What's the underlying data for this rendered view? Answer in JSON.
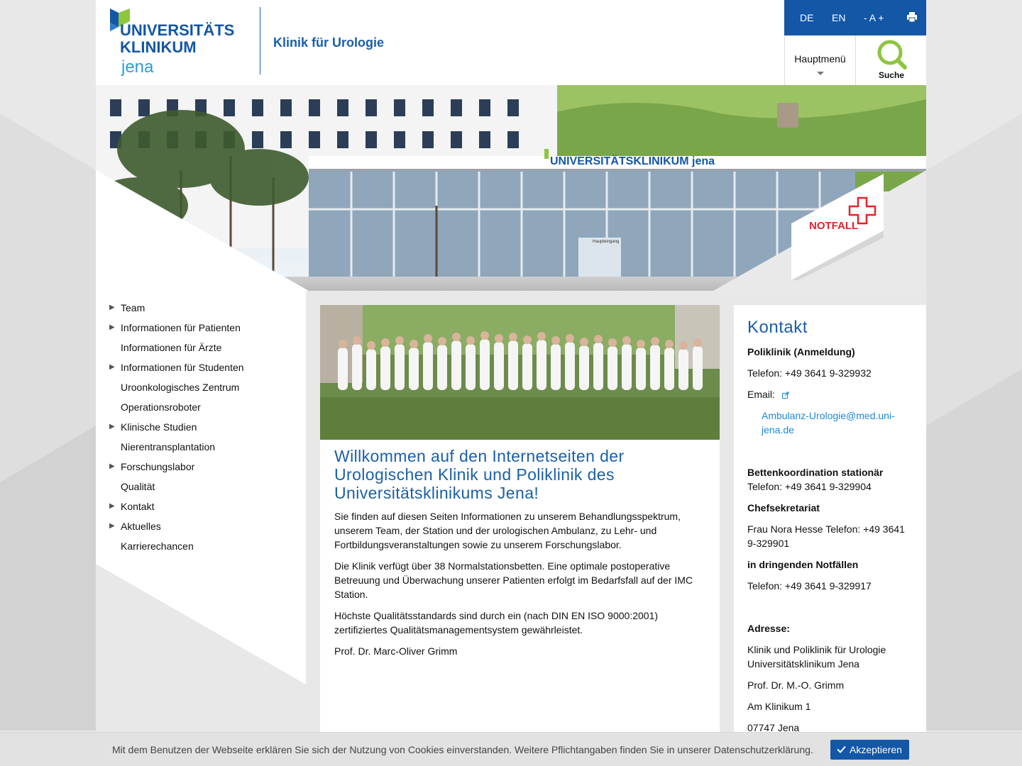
{
  "header": {
    "logo_line1": "UNIVERSITÄTS",
    "logo_line2": "KLINIKUM",
    "logo_line3": "jena",
    "clinic_title": "Klinik für Urologie",
    "lang_de": "DE",
    "lang_en": "EN",
    "font_size": "- A +",
    "menu_label": "Hauptmenü",
    "search_label": "Suche",
    "brand_color": "#1357a6",
    "logo_green": "#8dc63f"
  },
  "hero": {
    "building_sign": "UNIVERSITÄTSKLINIKUM jena",
    "entrance_sign": "Haupteingang",
    "emergency_label": "NOTFALL"
  },
  "sidebar": {
    "items": [
      {
        "label": "Team",
        "has_children": true
      },
      {
        "label": "Informationen für Patienten",
        "has_children": true
      },
      {
        "label": "Informationen für Ärzte",
        "has_children": false
      },
      {
        "label": "Informationen für Studenten",
        "has_children": true
      },
      {
        "label": "Uroonkologisches Zentrum",
        "has_children": false
      },
      {
        "label": "Operationsroboter",
        "has_children": false
      },
      {
        "label": "Klinische Studien",
        "has_children": true
      },
      {
        "label": "Nierentransplantation",
        "has_children": false
      },
      {
        "label": "Forschungslabor",
        "has_children": true
      },
      {
        "label": "Qualität",
        "has_children": false
      },
      {
        "label": "Kontakt",
        "has_children": true
      },
      {
        "label": "Aktuelles",
        "has_children": true
      },
      {
        "label": "Karrierechancen",
        "has_children": false
      }
    ]
  },
  "main": {
    "heading": "Willkommen auf den Internetseiten der Urologischen Klinik und Poliklinik des Universitätsklinikums Jena!",
    "paragraphs": [
      "Sie finden auf diesen Seiten Informationen zu unserem Behandlungsspektrum, unserem Team, der Station und der urologischen Ambulanz, zu Lehr- und Fortbildungsveranstaltungen sowie zu unserem Forschungslabor.",
      "Die Klinik verfügt über 38 Normalstationsbetten. Eine optimale postoperative Betreuung und Überwachung unserer Patienten erfolgt im Bedarfsfall auf der IMC Station.",
      "Höchste Qualitätsstandards sind durch ein (nach DIN EN ISO 9000:2001) zertifiziertes Qualitätsmanagementsystem gewährleistet.",
      "Prof. Dr. Marc-Oliver Grimm"
    ]
  },
  "contact": {
    "title": "Kontakt",
    "poliklinik_heading": "Poliklinik (Anmeldung)",
    "poliklinik_phone": "Telefon: +49 3641 9-329932",
    "email_label": "Email:",
    "email_value": "Ambulanz-Urologie@med.uni-jena.de",
    "betten_heading": "Bettenkoordination stationär",
    "betten_phone": "Telefon: +49 3641 9-329904",
    "chef_heading": "Chefsekretariat",
    "chef_text": "Frau Nora Hesse Telefon: +49 3641 9-329901",
    "notfall_heading": "in dringenden Notfällen",
    "notfall_phone": "Telefon: +49 3641 9-329917",
    "address_heading": "Adresse:",
    "address_clinic": "Klinik und Poliklinik für Urologie Universitätsklinikum Jena",
    "address_person": "Prof. Dr. M.-O. Grimm",
    "address_street": "Am Klinikum 1",
    "address_city": "07747 Jena"
  },
  "cookie": {
    "message": "Mit dem Benutzen der Webseite erklären Sie sich der Nutzung von Cookies einverstanden. Weitere Pflichtangaben finden Sie in unserer Datenschutzerklärung.",
    "accept_label": "Akzeptieren"
  }
}
